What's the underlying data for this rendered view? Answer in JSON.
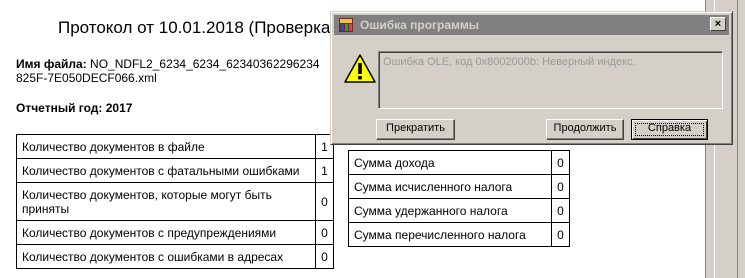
{
  "report": {
    "title": "Протокол от 10.01.2018 (Проверка",
    "file_label": "Имя файла:",
    "file_name": "NO_NDFL2_6234_6234_62340362296234 825F-7E050DECF066.xml",
    "year_line": "Отчетный год: 2017",
    "documents_table": [
      {
        "name": "Количество документов в файле",
        "value": "1"
      },
      {
        "name": "Количество документов с фатальными ошибками",
        "value": "1"
      },
      {
        "name": "Количество документов, которые могут быть приняты",
        "value": "0"
      },
      {
        "name": "Количество документов с предупреждениями",
        "value": "0"
      },
      {
        "name": "Количество документов с ошибками в адресах",
        "value": "0"
      }
    ],
    "sums_table": [
      {
        "name": "Сумма дохода",
        "value": "0"
      },
      {
        "name": "Сумма исчисленного налога",
        "value": "0"
      },
      {
        "name": "Сумма удержанного налога",
        "value": "0"
      },
      {
        "name": "Сумма перечисленного налога",
        "value": "0"
      }
    ]
  },
  "dialog": {
    "title": "Ошибка программы",
    "close_glyph": "×",
    "icon": "warning-icon",
    "message": "Ошибка OLE, код 0x8002000b: Неверный индекс.",
    "buttons": {
      "abort": "Прекратить",
      "continue": "Продолжить",
      "help": "Справка"
    }
  },
  "colors": {
    "titlebar_inactive": "#808080",
    "dialog_face": "#d4d0c8",
    "warning_yellow": "#ffff00"
  }
}
